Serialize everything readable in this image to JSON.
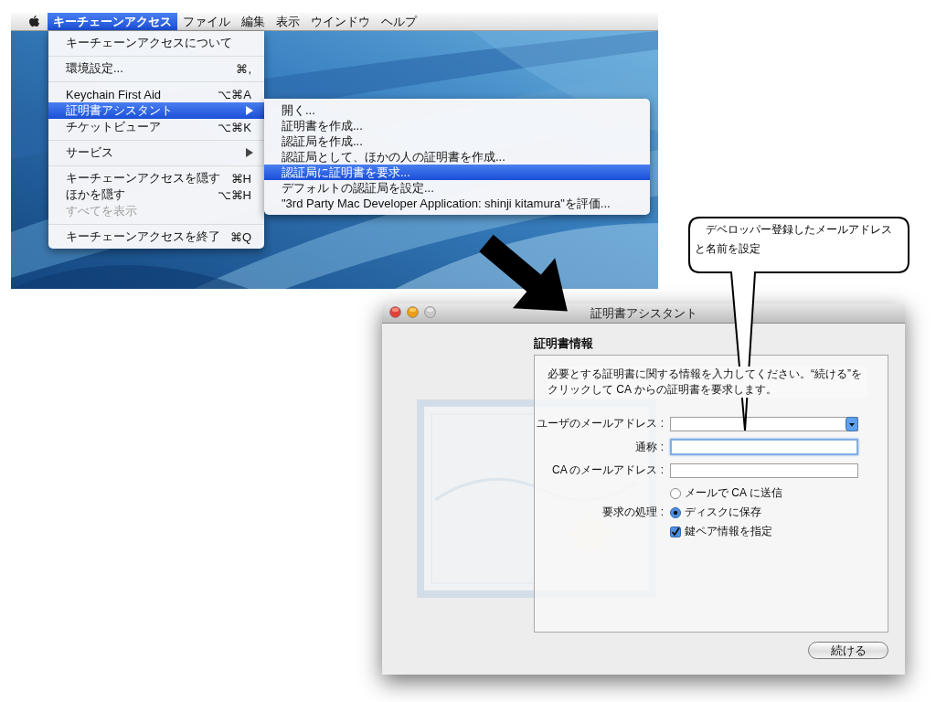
{
  "menubar": {
    "items": [
      {
        "label": "キーチェーンアクセス",
        "selected": true
      },
      {
        "label": "ファイル",
        "selected": false
      },
      {
        "label": "編集",
        "selected": false
      },
      {
        "label": "表示",
        "selected": false
      },
      {
        "label": "ウインドウ",
        "selected": false
      },
      {
        "label": "ヘルプ",
        "selected": false
      }
    ]
  },
  "app_menu": {
    "items": [
      {
        "kind": "item",
        "label": "キーチェーンアクセスについて",
        "selected": false,
        "disabled": false,
        "has_submenu": false
      },
      {
        "kind": "separator"
      },
      {
        "kind": "item",
        "label": "環境設定...",
        "shortcut": "⌘,",
        "selected": false,
        "disabled": false,
        "has_submenu": false
      },
      {
        "kind": "separator"
      },
      {
        "kind": "item",
        "label": "Keychain First Aid",
        "shortcut": "⌥⌘A",
        "selected": false,
        "disabled": false,
        "has_submenu": false
      },
      {
        "kind": "item",
        "label": "証明書アシスタント",
        "selected": true,
        "disabled": false,
        "has_submenu": true
      },
      {
        "kind": "item",
        "label": "チケットビューア",
        "shortcut": "⌥⌘K",
        "selected": false,
        "disabled": false,
        "has_submenu": false
      },
      {
        "kind": "separator"
      },
      {
        "kind": "item",
        "label": "サービス",
        "selected": false,
        "disabled": false,
        "has_submenu": true
      },
      {
        "kind": "separator"
      },
      {
        "kind": "item",
        "label": "キーチェーンアクセスを隠す",
        "shortcut": "⌘H",
        "selected": false,
        "disabled": false,
        "has_submenu": false
      },
      {
        "kind": "item",
        "label": "ほかを隠す",
        "shortcut": "⌥⌘H",
        "selected": false,
        "disabled": false,
        "has_submenu": false
      },
      {
        "kind": "item",
        "label": "すべてを表示",
        "selected": false,
        "disabled": true,
        "has_submenu": false
      },
      {
        "kind": "separator"
      },
      {
        "kind": "item",
        "label": "キーチェーンアクセスを終了",
        "shortcut": "⌘Q",
        "selected": false,
        "disabled": false,
        "has_submenu": false
      }
    ]
  },
  "submenu": {
    "items": [
      {
        "kind": "item",
        "label": "開く...",
        "selected": false,
        "disabled": false,
        "has_submenu": false
      },
      {
        "kind": "item",
        "label": "証明書を作成...",
        "selected": false,
        "disabled": false,
        "has_submenu": false
      },
      {
        "kind": "item",
        "label": "認証局を作成...",
        "selected": false,
        "disabled": false,
        "has_submenu": false
      },
      {
        "kind": "item",
        "label": "認証局として、ほかの人の証明書を作成...",
        "selected": false,
        "disabled": false,
        "has_submenu": false
      },
      {
        "kind": "item",
        "label": "認証局に証明書を要求...",
        "selected": true,
        "disabled": false,
        "has_submenu": false
      },
      {
        "kind": "item",
        "label": "デフォルトの認証局を設定...",
        "selected": false,
        "disabled": false,
        "has_submenu": false
      },
      {
        "kind": "item",
        "label": "\"3rd Party Mac Developer Application: shinji kitamura\"を評価...",
        "selected": false,
        "disabled": false,
        "has_submenu": false
      }
    ]
  },
  "callout": {
    "text": "デベロッパー登録したメールアドレスと名前を設定"
  },
  "dialog": {
    "title": "証明書アシスタント",
    "heading": "証明書情報",
    "intro": "必要とする証明書に関する情報を入力してください。“続ける”をクリックして CA からの証明書を要求します。",
    "fields": [
      {
        "label": "ユーザのメールアドレス :",
        "kind": "combo",
        "focused": false
      },
      {
        "label": "通称 :",
        "kind": "text",
        "focused": true
      },
      {
        "label": "CA のメールアドレス :",
        "kind": "text",
        "focused": false
      }
    ],
    "request": {
      "label": "要求の処理 :",
      "options": [
        {
          "label": "メールで CA に送信",
          "selected": false
        },
        {
          "label": "ディスクに保存",
          "selected": true
        }
      ]
    },
    "checkbox": {
      "label": "鍵ペア情報を指定",
      "checked": true
    },
    "buttons": [
      {
        "label": "続ける"
      }
    ]
  }
}
